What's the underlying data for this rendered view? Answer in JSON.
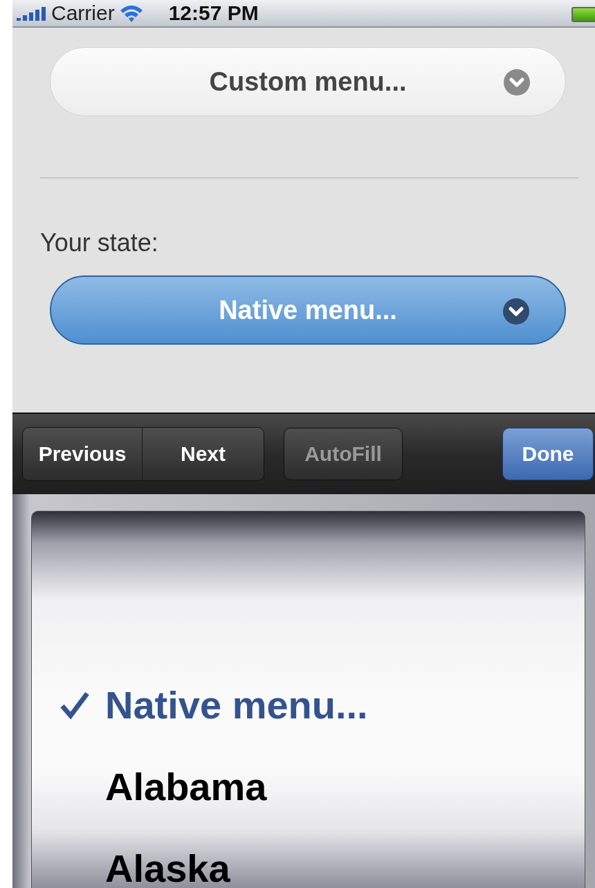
{
  "status_bar": {
    "carrier": "Carrier",
    "time": "12:57 PM"
  },
  "custom_menu": {
    "label": "Custom menu..."
  },
  "state_label": "Your state:",
  "native_menu": {
    "label": "Native menu...",
    "selected": true
  },
  "toolbar": {
    "buttons": [
      {
        "label": "Previous",
        "kind": "segment",
        "disabled": false
      },
      {
        "label": "Next",
        "kind": "segment",
        "disabled": false
      },
      {
        "label": "AutoFill",
        "kind": "plain",
        "disabled": true
      },
      {
        "label": "Done",
        "kind": "done",
        "disabled": false
      }
    ]
  },
  "picker": {
    "options": [
      {
        "label": "Native menu...",
        "selected": true
      },
      {
        "label": "Alabama",
        "selected": false
      },
      {
        "label": "Alaska",
        "selected": false
      }
    ]
  }
}
